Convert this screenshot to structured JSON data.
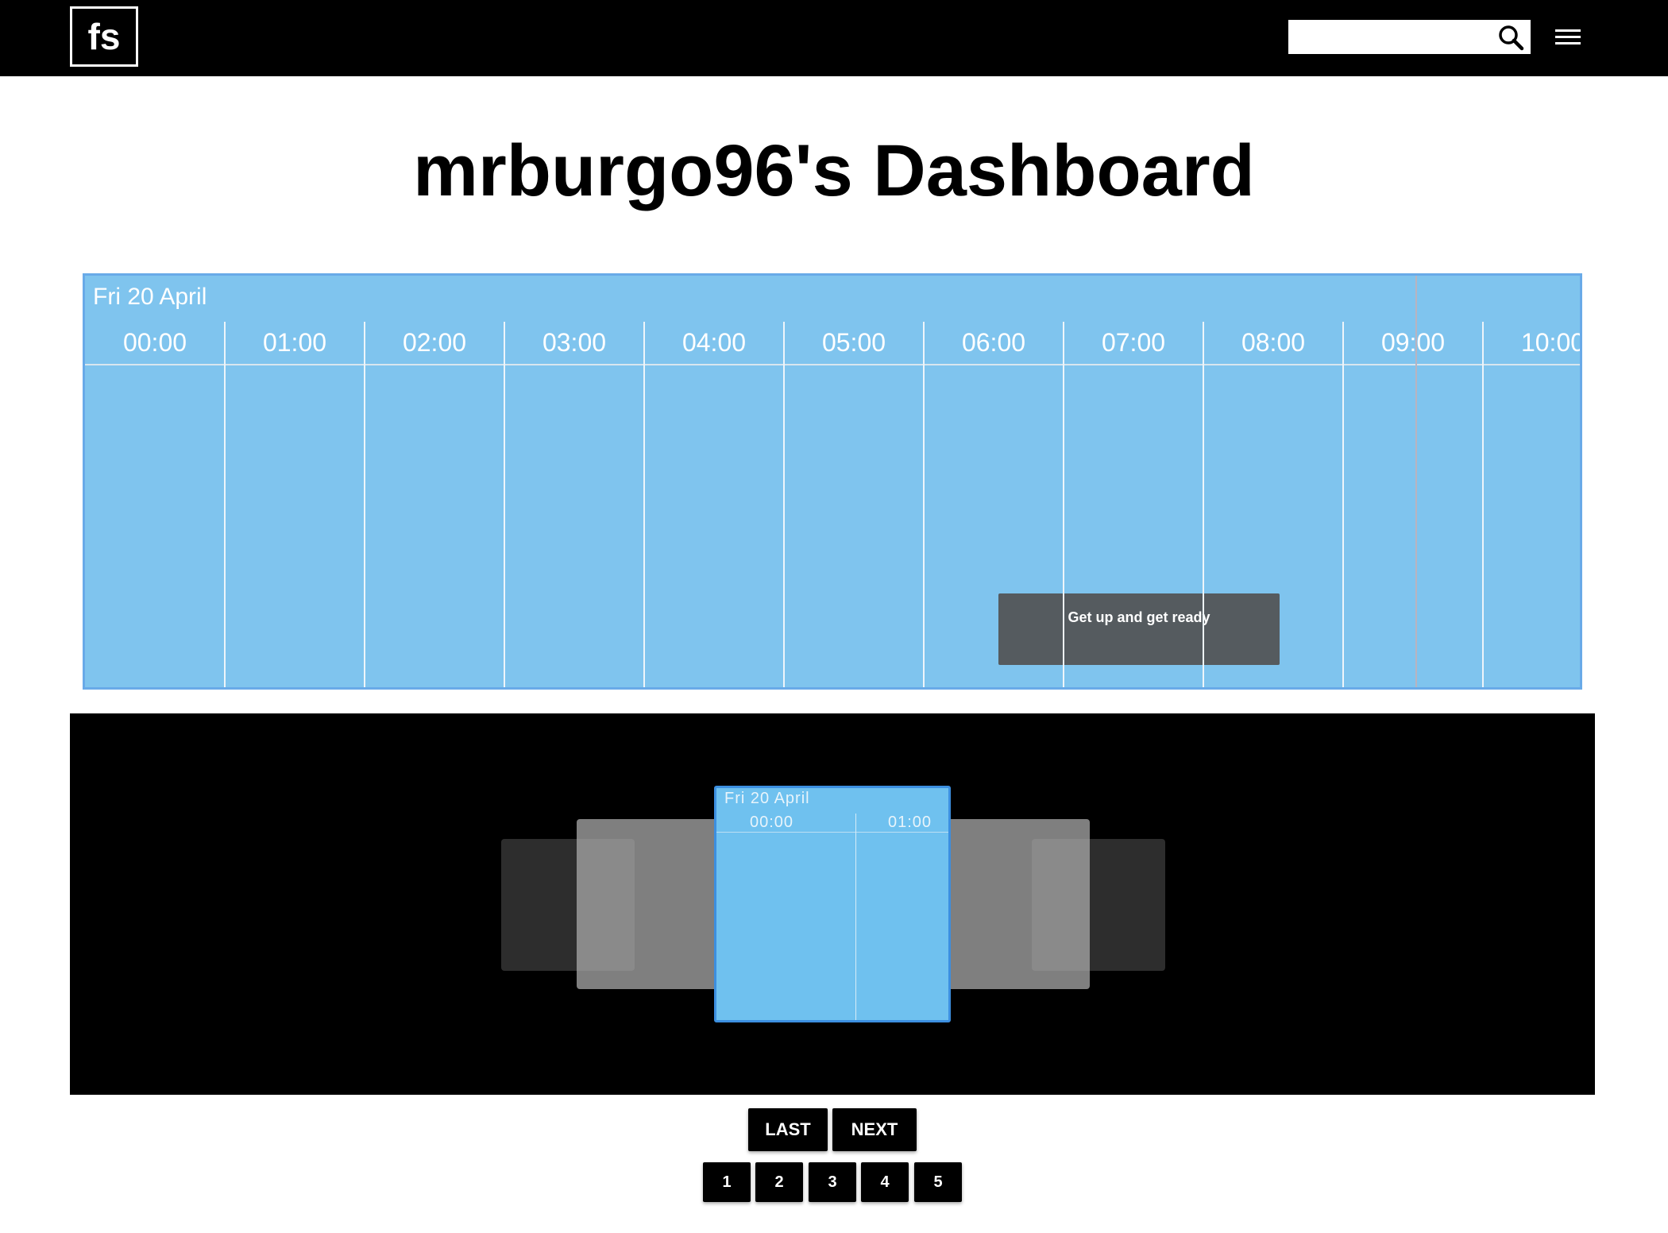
{
  "header": {
    "logo_text": "fs",
    "search_placeholder": "",
    "search_icon": "search-icon",
    "menu_icon": "hamburger-menu-icon"
  },
  "page_title": "mrburgo96's Dashboard",
  "timeline": {
    "date": "Fri 20 April",
    "hours": [
      "00:00",
      "01:00",
      "02:00",
      "03:00",
      "04:00",
      "05:00",
      "06:00",
      "07:00",
      "08:00",
      "09:00",
      "10:00"
    ],
    "event": {
      "label": "Get up and get ready"
    }
  },
  "carousel": {
    "preview": {
      "date": "Fri 20 April",
      "hours": [
        "00:00",
        "01:00"
      ]
    }
  },
  "pagination": {
    "last_label": "LAST",
    "next_label": "NEXT",
    "pages": [
      "1",
      "2",
      "3",
      "4",
      "5"
    ]
  },
  "colors": {
    "timeline_bg": "#7fc4ee",
    "timeline_border": "#69aae8",
    "event_bg": "#555b5f",
    "topbar_bg": "#000000",
    "carousel_bg": "#000000"
  }
}
